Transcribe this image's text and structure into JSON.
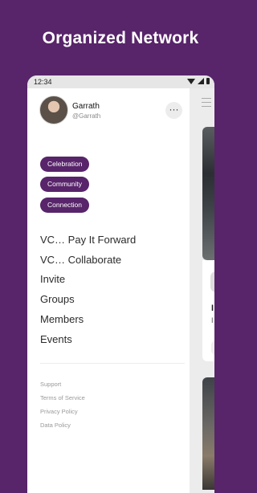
{
  "headline": "Organized Network",
  "status_bar": {
    "time": "12:34",
    "icons": [
      "wifi-icon",
      "signal-icon",
      "battery-icon"
    ]
  },
  "profile": {
    "name": "Garrath",
    "handle": "@Garrath",
    "more_label": "···"
  },
  "chips": [
    "Celebration",
    "Community",
    "Connection"
  ],
  "menu": [
    "VC… Pay It Forward",
    "VC… Collaborate",
    "Invite",
    "Groups",
    "Members",
    "Events"
  ],
  "footer_links": [
    "Support",
    "Terms of Service",
    "Privacy Policy",
    "Data Policy"
  ],
  "background_card": {
    "title_fragment": "I",
    "subtitle_fragment": "I"
  },
  "colors": {
    "brand_purple": "#58246a",
    "drawer_bg": "#ffffff",
    "status_bar_bg": "#e6e6e6"
  }
}
